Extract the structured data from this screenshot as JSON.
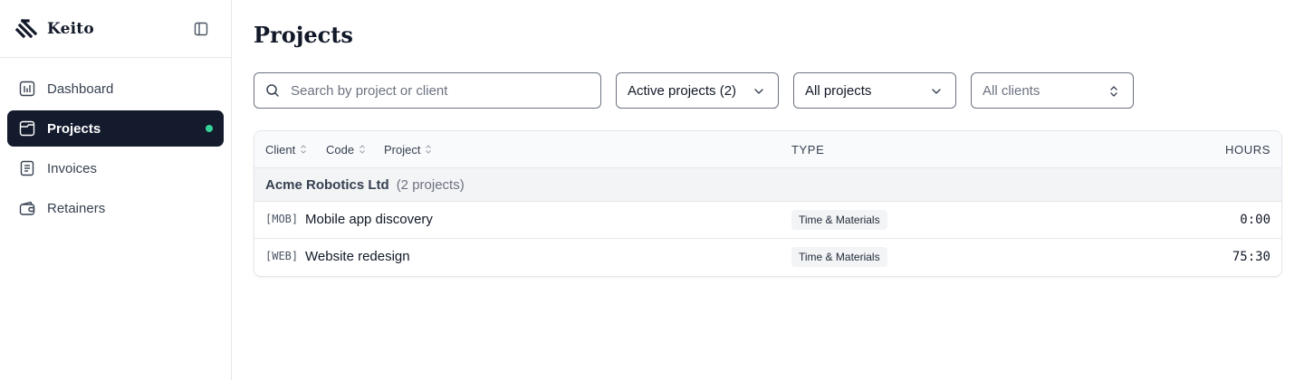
{
  "app": {
    "name": "Keito"
  },
  "sidebar": {
    "items": [
      {
        "label": "Dashboard",
        "icon": "bar-chart-icon",
        "active": false
      },
      {
        "label": "Projects",
        "icon": "folder-icon",
        "active": true
      },
      {
        "label": "Invoices",
        "icon": "document-icon",
        "active": false
      },
      {
        "label": "Retainers",
        "icon": "wallet-icon",
        "active": false
      }
    ]
  },
  "page": {
    "title": "Projects"
  },
  "filters": {
    "search_placeholder": "Search by project or client",
    "status": "Active projects (2)",
    "scope": "All projects",
    "clients": "All clients"
  },
  "table": {
    "headers": {
      "client": "Client",
      "code": "Code",
      "project": "Project",
      "type": "TYPE",
      "hours": "HOURS"
    },
    "groups": [
      {
        "client": "Acme Robotics Ltd",
        "count_label": "(2 projects)",
        "rows": [
          {
            "code": "[MOB]",
            "name": "Mobile app discovery",
            "type": "Time & Materials",
            "hours": "0:00"
          },
          {
            "code": "[WEB]",
            "name": "Website redesign",
            "type": "Time & Materials",
            "hours": "75:30"
          }
        ]
      }
    ]
  },
  "colors": {
    "active_nav_bg": "#141b2d",
    "status_dot": "#34d399",
    "border": "#e5e7eb"
  }
}
